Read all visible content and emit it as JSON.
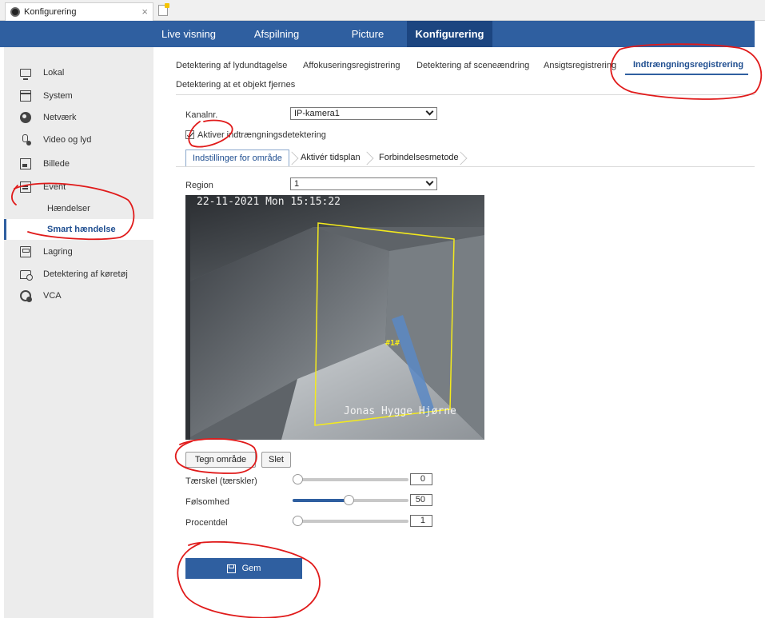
{
  "browser": {
    "tab_title": "Konfigurering",
    "tab_close": "×"
  },
  "topnav": {
    "items": [
      {
        "label": "Live visning",
        "active": false
      },
      {
        "label": "Afspilning",
        "active": false
      },
      {
        "label": "Picture",
        "active": false
      },
      {
        "label": "Konfigurering",
        "active": true
      }
    ]
  },
  "sidebar": {
    "items": [
      {
        "label": "Lokal",
        "icon": "monitor-icon"
      },
      {
        "label": "System",
        "icon": "window-icon"
      },
      {
        "label": "Netværk",
        "icon": "globe-icon"
      },
      {
        "label": "Video og lyd",
        "icon": "microphone-icon"
      },
      {
        "label": "Billede",
        "icon": "image-icon"
      },
      {
        "label": "Event",
        "icon": "calendar-icon"
      },
      {
        "label": "Hændelser",
        "sub": true
      },
      {
        "label": "Smart hændelse",
        "sub": true,
        "active": true
      },
      {
        "label": "Lagring",
        "icon": "storage-icon"
      },
      {
        "label": "Detektering af køretøj",
        "icon": "vehicle-detection-icon"
      },
      {
        "label": "VCA",
        "icon": "vca-icon"
      }
    ]
  },
  "subtabs": [
    {
      "label": "Detektering af lydundtagelse"
    },
    {
      "label": "Affokuseringsregistrering"
    },
    {
      "label": "Detektering af sceneændring"
    },
    {
      "label": "Ansigtsregistrering"
    },
    {
      "label": "Indtrængningsregistrering",
      "active": true
    },
    {
      "label": "Detektering at et objekt fjernes"
    }
  ],
  "form": {
    "channel_label": "Kanalnr.",
    "channel_value": "IP-kamera1",
    "enable_label": "Aktiver indtrængningsdetektering",
    "enable_checked": true,
    "steps": [
      "Indstillinger for område",
      "Aktivér tidsplan",
      "Forbindelsesmetode"
    ],
    "region_label": "Region",
    "region_value": "1"
  },
  "video": {
    "timestamp": "22-11-2021 Mon 15:15:22",
    "camera_name": "Jonas Hygge Hjørne",
    "region_tag": "#1#"
  },
  "buttons": {
    "draw_area": "Tegn område",
    "delete": "Slet",
    "save": "Gem"
  },
  "sliders": [
    {
      "label": "Tærskel (tærskler)",
      "value": "0",
      "fraction": 0.0
    },
    {
      "label": "Følsomhed",
      "value": "50",
      "fraction": 0.5
    },
    {
      "label": "Procentdel",
      "value": "1",
      "fraction": 0.01
    }
  ],
  "colors": {
    "nav_blue": "#2f5fa0",
    "nav_active": "#1c4580",
    "annotation_red": "#e01a1a",
    "region_yellow": "#f4ea1c"
  }
}
